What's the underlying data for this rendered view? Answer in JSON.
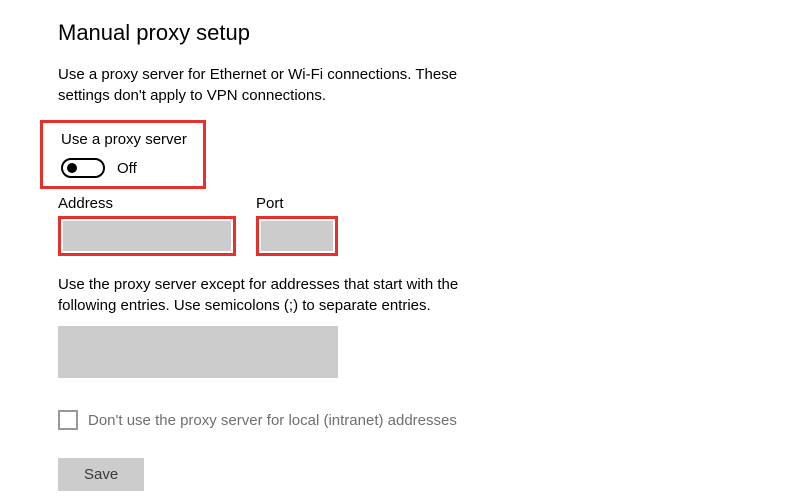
{
  "title": "Manual proxy setup",
  "description": "Use a proxy server for Ethernet or Wi-Fi connections. These settings don't apply to VPN connections.",
  "toggle": {
    "label": "Use a proxy server",
    "state": "Off",
    "on": false
  },
  "address": {
    "label": "Address",
    "value": ""
  },
  "port": {
    "label": "Port",
    "value": ""
  },
  "exceptions": {
    "description": "Use the proxy server except for addresses that start with the following entries. Use semicolons (;) to separate entries.",
    "value": ""
  },
  "bypass_local": {
    "label": "Don't use the proxy server for local (intranet) addresses",
    "checked": false
  },
  "save_label": "Save"
}
